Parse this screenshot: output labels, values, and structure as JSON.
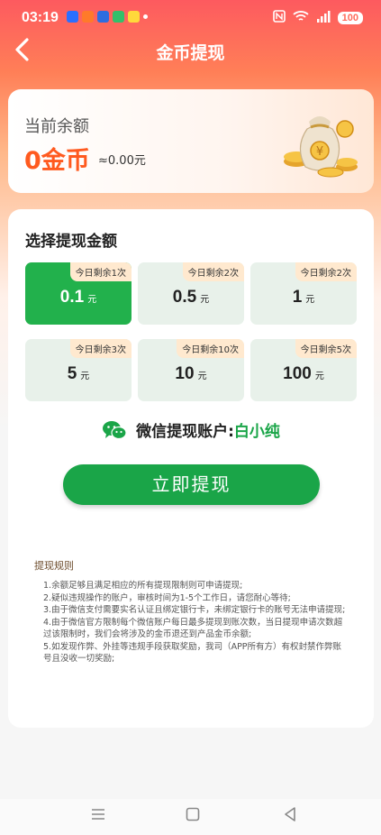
{
  "status_bar": {
    "time": "03:19",
    "battery": "100",
    "signal": "5G"
  },
  "header": {
    "title": "金币提现"
  },
  "balance": {
    "label": "当前余额",
    "value": "0金币",
    "approx": "≈0.00元"
  },
  "withdraw": {
    "section_title": "选择提现金额",
    "options": [
      {
        "amount": "0.1",
        "unit": "元",
        "badge": "今日剩余1次",
        "selected": true
      },
      {
        "amount": "0.5",
        "unit": "元",
        "badge": "今日剩余2次",
        "selected": false
      },
      {
        "amount": "1",
        "unit": "元",
        "badge": "今日剩余2次",
        "selected": false
      },
      {
        "amount": "5",
        "unit": "元",
        "badge": "今日剩余3次",
        "selected": false
      },
      {
        "amount": "10",
        "unit": "元",
        "badge": "今日剩余10次",
        "selected": false
      },
      {
        "amount": "100",
        "unit": "元",
        "badge": "今日剩余5次",
        "selected": false
      }
    ],
    "account_label": "微信提现账户:",
    "account_name": "白小纯",
    "button_label": "立即提现"
  },
  "rules": {
    "title": "提现规则",
    "items": [
      "1.余额足够且满足相应的所有提现限制则可申请提现;",
      "2.疑似违规操作的账户，审核时间为1-5个工作日，请您耐心等待;",
      "3.由于微信支付需要实名认证且绑定银行卡，未绑定银行卡的账号无法申请提现;",
      "4.由于微信官方限制每个微信账户每日最多提现到账次数，当日提现申请次数超过该限制时，我们会将涉及的金币退还到产品金币余额;",
      "5.如发现作弊、外挂等违规手段获取奖励，我司（APP所有方）有权封禁作弊账号且没收一切奖励;"
    ]
  },
  "colors": {
    "accent": "#1aa548",
    "selected_option": "#22b14c",
    "balance": "#ff5a1f",
    "header_gradient_top": "#fd5a5f"
  }
}
